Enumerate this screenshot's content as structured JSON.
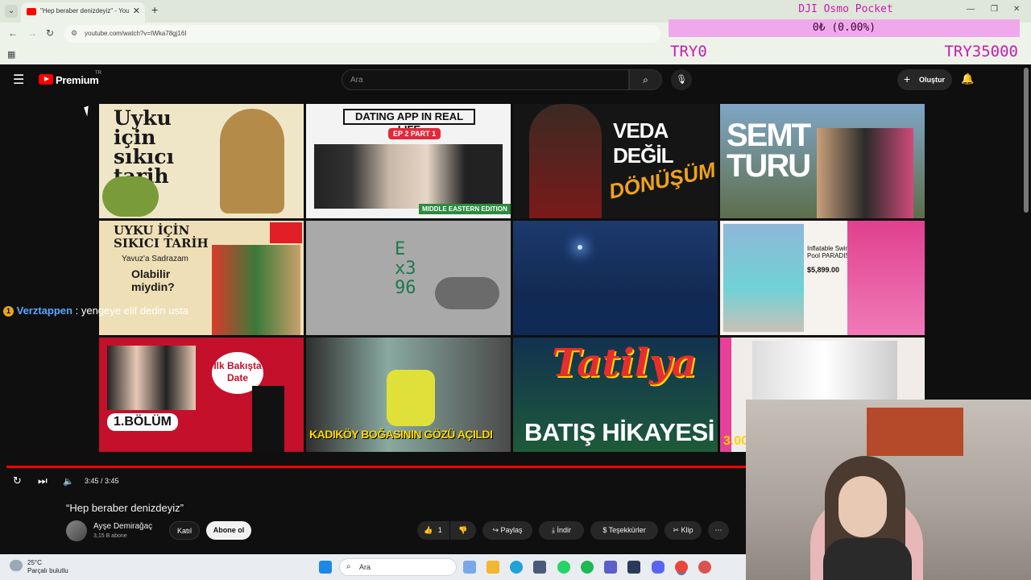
{
  "browser": {
    "tab_title": "\"Hep beraber denizdeyiz\" - You",
    "url": "youtube.com/watch?v=IWka78gj16I"
  },
  "overlay": {
    "title": "DJI Osmo Pocket",
    "percent": "0₺ (0.00%)",
    "progress_fraction": 0,
    "min_label": "TRY0",
    "max_label": "TRY35000"
  },
  "youtube": {
    "brand": "Premium",
    "region": "TR",
    "search_placeholder": "Ara",
    "create_label": "Oluştur"
  },
  "thumbnails": [
    {
      "caption": "Uyku için sıkıcı tarih"
    },
    {
      "caption": "DATING APP IN REAL LIFE",
      "sub": "EP 2 PART 1",
      "foot": "MIDDLE EASTERN EDITION"
    },
    {
      "caption": "VEDA DEĞİL",
      "sub": "DÖNÜŞÜM"
    },
    {
      "caption": "SEMT TURU"
    },
    {
      "caption": "UYKU İÇİN SIKICI TARİH",
      "sub": "Yavuz'a Sadrazam",
      "foot": "Olabilir miydin?"
    },
    {
      "caption": "E x3 96"
    },
    {
      "caption": ""
    },
    {
      "caption": "Inflatable Swim Pool PARADISE",
      "sub": "$5,899.00"
    },
    {
      "caption": "İlk Bakışta Date",
      "sub": "1.BÖLÜM"
    },
    {
      "caption": "KADIKÖY BOĞASININ GÖZÜ AÇILDI"
    },
    {
      "caption": "Tatilya",
      "sub": "BATIŞ HİKAYESİ"
    },
    {
      "caption": "3.00"
    }
  ],
  "chat": {
    "badge": "1",
    "user": "Verztappen",
    "message": ": yengeye elif dedin usta"
  },
  "player": {
    "time": "3:45 / 3:45",
    "progress_fraction": 1
  },
  "video": {
    "title": "“Hep beraber denizdeyiz”",
    "channel": "Ayşe Demirağaç",
    "subs": "3,15 B abone",
    "join_label": "Katıl",
    "subscribe_label": "Abone ol",
    "likes": "1",
    "share_label": "Paylaş",
    "download_label": "İndir",
    "thanks_label": "Teşekkürler",
    "clip_label": "Klip"
  },
  "taskbar": {
    "temp": "25°C",
    "weather": "Parçalı bulutlu",
    "search": "Ara"
  }
}
